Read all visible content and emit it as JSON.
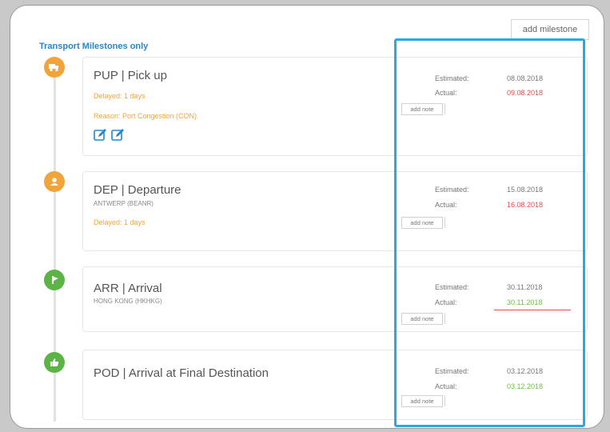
{
  "header": {
    "add_milestone": "add milestone",
    "section_title": "Transport Milestones only"
  },
  "labels": {
    "estimated": "Estimated:",
    "actual": "Actual:",
    "add_note": "add note"
  },
  "colors": {
    "orange": "#f2a43b",
    "green": "#5cb346",
    "red": "#e54b4b",
    "blue": "#2a86c9",
    "highlight": "#2aa9e0"
  },
  "milestones": [
    {
      "title": "PUP | Pick up",
      "icon": "truck-icon",
      "delayed": "Delayed: 1 days",
      "reason": "Reason: Port Congestion (CON)",
      "estimated": "08.08.2018",
      "actual": "09.08.2018",
      "actual_status": "late"
    },
    {
      "title": "DEP | Departure",
      "icon": "person-icon",
      "location": "ANTWERP (BEANR)",
      "delayed": "Delayed: 1 days",
      "estimated": "15.08.2018",
      "actual": "16.08.2018",
      "actual_status": "late"
    },
    {
      "title": "ARR | Arrival",
      "icon": "ship-icon",
      "location": "HONG KONG (HKHKG)",
      "estimated": "30.11.2018",
      "actual": "30.11.2018",
      "actual_status": "on-time"
    },
    {
      "title": "POD | Arrival at Final Destination",
      "icon": "thumbs-up-icon",
      "estimated": "03.12.2018",
      "actual": "03.12.2018",
      "actual_status": "on-time"
    }
  ]
}
